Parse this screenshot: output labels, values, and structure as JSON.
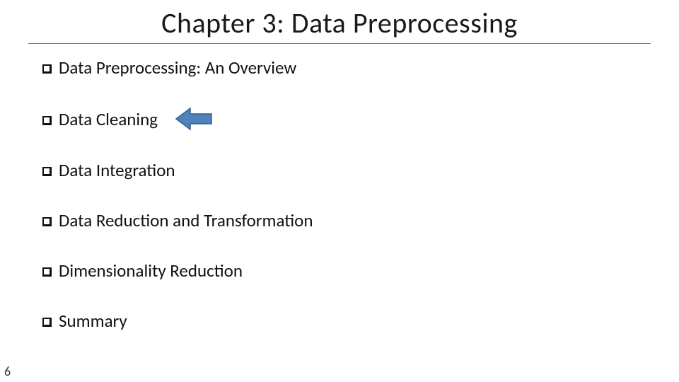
{
  "title": "Chapter 3: Data Preprocessing",
  "items": [
    {
      "label": "Data Preprocessing: An Overview",
      "highlighted": false
    },
    {
      "label": "Data Cleaning",
      "highlighted": true
    },
    {
      "label": "Data Integration",
      "highlighted": false
    },
    {
      "label": "Data Reduction and Transformation",
      "highlighted": false
    },
    {
      "label": "Dimensionality Reduction",
      "highlighted": false
    },
    {
      "label": "Summary",
      "highlighted": false
    }
  ],
  "page_number": "6",
  "arrow": {
    "semantic": "left-arrow-icon",
    "fill": "#4f81bd",
    "stroke": "#385d8a"
  }
}
